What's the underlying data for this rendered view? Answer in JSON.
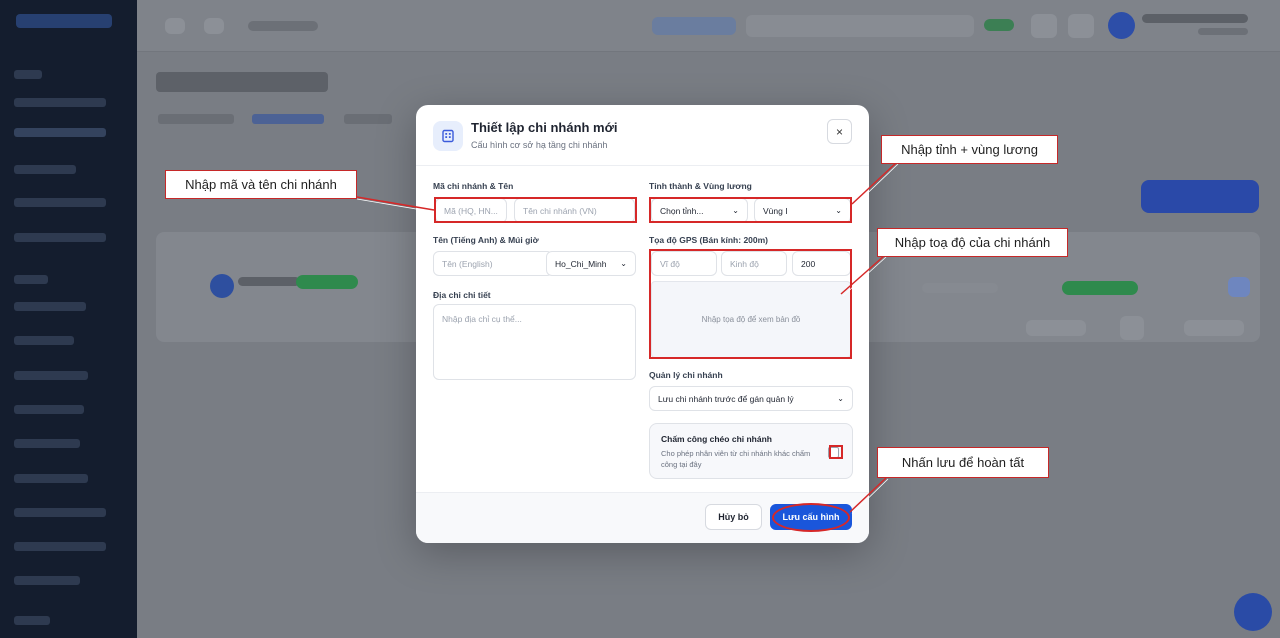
{
  "modal": {
    "title": "Thiết lập chi nhánh mới",
    "subtitle": "Cấu hình cơ sở hạ tầng chi nhánh",
    "close_label": "×",
    "code_name": {
      "label": "Mã chi nhánh & Tên",
      "code_placeholder": "Mã (HQ, HN...",
      "name_placeholder": "Tên chi nhánh (VN)"
    },
    "english_tz": {
      "label": "Tên (Tiếng Anh) & Múi giờ",
      "english_placeholder": "Tên (English)",
      "timezone_value": "Ho_Chi_Minh"
    },
    "address": {
      "label": "Địa chỉ chi tiết",
      "placeholder": "Nhập địa chỉ cụ thể..."
    },
    "province_zone": {
      "label": "Tỉnh thành & Vùng lương",
      "province_value": "Chọn tỉnh...",
      "zone_value": "Vùng I"
    },
    "gps": {
      "label": "Tọa độ GPS (Bán kính: 200m)",
      "lat_placeholder": "Vĩ độ",
      "lng_placeholder": "Kinh độ",
      "radius_value": "200",
      "map_hint": "Nhập tọa độ để xem bản đồ"
    },
    "manager": {
      "label": "Quản lý chi nhánh",
      "value": "Lưu chi nhánh trước để gán quản lý"
    },
    "cross_checkin": {
      "title": "Chấm công chéo chi nhánh",
      "description": "Cho phép nhân viên từ chi nhánh khác chấm công tại đây"
    },
    "cancel_label": "Hủy bỏ",
    "save_label": "Lưu cấu hình"
  },
  "annotations": {
    "code_name": "Nhập mã và tên chi nhánh",
    "province_zone": "Nhập tỉnh + vùng lương",
    "gps": "Nhập toạ độ của chi nhánh",
    "save": "Nhấn lưu để hoàn tất"
  },
  "colors": {
    "accent": "#1a56db",
    "annotation": "#d62828",
    "sidebar": "#141d2e"
  }
}
